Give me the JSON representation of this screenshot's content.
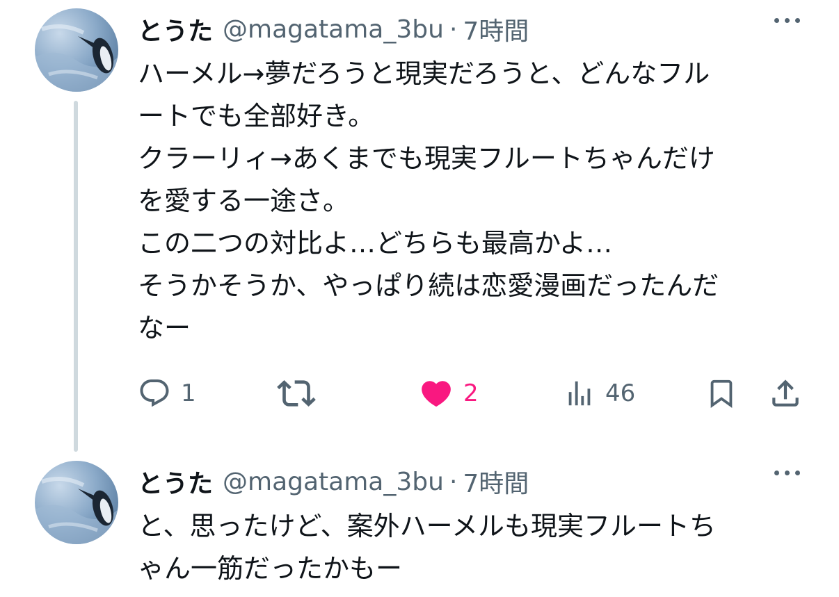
{
  "tweets": [
    {
      "author": {
        "name": "とうた",
        "handle": "@magatama_3bu",
        "separator": "·",
        "time": "7時間"
      },
      "text": "ハーメル→夢だろうと現実だろうと、どんなフル\nートでも全部好き。\nクラーリィ→あくまでも現実フルートちゃんだけ\nを愛する一途さ。\nこの二つの対比よ…どちらも最高かよ…\nそうかそうか、やっぱり続は恋愛漫画だったんだ\nなー",
      "actions": {
        "reply_count": "1",
        "retweet_count": "",
        "like_count": "2",
        "views_count": "46"
      }
    },
    {
      "author": {
        "name": "とうた",
        "handle": "@magatama_3bu",
        "separator": "·",
        "time": "7時間"
      },
      "text": "と、思ったけど、案外ハーメルも現実フルートち\nゃん一筋だったかもー"
    }
  ],
  "icons": {
    "reply": "reply-icon",
    "retweet": "retweet-icon",
    "like": "heart-icon",
    "views": "views-icon",
    "bookmark": "bookmark-icon",
    "share": "share-icon",
    "more": "more-icon"
  },
  "colors": {
    "text": "#0f1419",
    "secondary": "#536471",
    "like": "#f91880",
    "thread_line": "#cfd9de"
  }
}
